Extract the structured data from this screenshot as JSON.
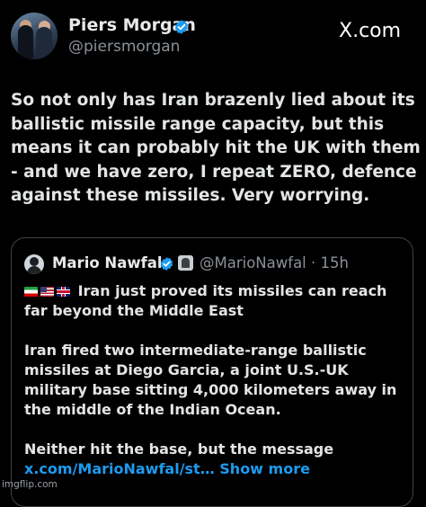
{
  "post": {
    "author_name": "Piers Morgan",
    "author_handle": "@piersmorgan",
    "site": "X.com",
    "text": "So not only has Iran brazenly lied about its ballistic missile range capacity, but this means it can probably hit the UK with them - and we have zero, I repeat ZERO, defence against these missiles. Very worrying."
  },
  "quote": {
    "author_name": "Mario Nawfal",
    "author_handle": "@MarioNawfal",
    "separator": " · ",
    "time": "15h",
    "flags": [
      "Iran flag",
      "US flag",
      "UK flag"
    ],
    "headline": "Iran just proved its missiles can reach far beyond the Middle East",
    "paragraph2": "Iran fired two intermediate-range ballistic missiles at Diego Garcia, a joint U.S.-UK military base sitting 4,000 kilometers away in the middle of the Indian Ocean.",
    "paragraph3_text": "Neither hit the base, but the message ",
    "link_text": "x.com/MarioNawfal/st…",
    "show_more": " Show more"
  },
  "watermark": "imgflip.com",
  "colors": {
    "background": "#000000",
    "text": "#e7e9ea",
    "secondary": "#8b9198",
    "link": "#1d9bf0",
    "verified": "#1d9bf0"
  }
}
